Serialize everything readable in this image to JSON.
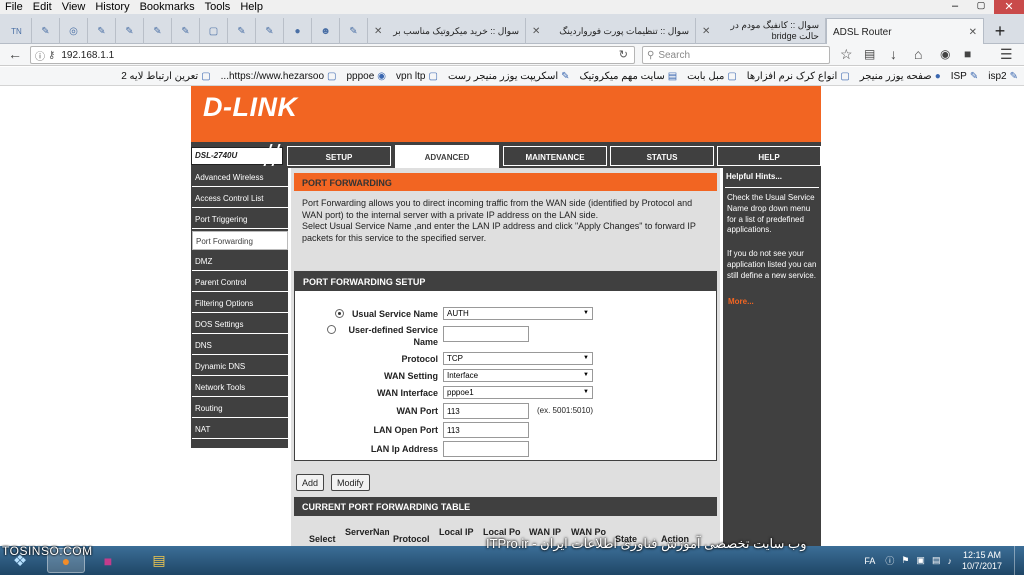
{
  "menubar": {
    "items": [
      "File",
      "Edit",
      "View",
      "History",
      "Bookmarks",
      "Tools",
      "Help"
    ]
  },
  "tabs": [
    {
      "label": "سوال :: خرید میکروتیک مناسب بر"
    },
    {
      "label": "سوال :: تنظیمات پورت فورواردینگ"
    },
    {
      "label": "سوال :: کانفیگ مودم در حالت bridge"
    },
    {
      "label": "ADSL Router"
    }
  ],
  "navbar": {
    "url": "192.168.1.1",
    "search_placeholder": "Search"
  },
  "bookmarks": [
    "isp2",
    "ISP",
    "صفحه یوزر منیجر",
    "انواع کرک نرم افزارها",
    "مبل بابت",
    "سایت مهم میکروتیک",
    "اسکریپت یوزر منیجر رست",
    "vpn ltp",
    "pppoe",
    "https://www.hezarsoo...",
    "تعرین ارتباط لایه 2"
  ],
  "router": {
    "logo": "D-LINK",
    "model": "DSL-2740U",
    "tabs": [
      "SETUP",
      "ADVANCED",
      "MAINTENANCE",
      "STATUS",
      "HELP"
    ],
    "left_nav": [
      "Advanced Wireless",
      "Access Control List",
      "Port Triggering",
      "Port Forwarding",
      "DMZ",
      "Parent Control",
      "Filtering Options",
      "DOS Settings",
      "DNS",
      "Dynamic DNS",
      "Network Tools",
      "Routing",
      "NAT"
    ],
    "pf_title": "PORT FORWARDING",
    "pf_text_1": "Port Forwarding allows you to direct incoming traffic from the WAN side (identified by Protocol and WAN port) to the internal server with a private IP address on the LAN side.",
    "pf_text_2": "Select Usual Service Name ,and enter the LAN IP address and click \"Apply Changes\" to forward IP packets for this service to the specified server.",
    "setup_title": "PORT FORWARDING SETUP",
    "form": {
      "usual_label": "Usual Service Name",
      "usual_value": "AUTH",
      "user_defined_label": "User-defined Service Name",
      "protocol_label": "Protocol",
      "protocol_value": "TCP",
      "wan_setting_label": "WAN Setting",
      "wan_setting_value": "Interface",
      "wan_interface_label": "WAN Interface",
      "wan_interface_value": "pppoe1",
      "wan_port_label": "WAN Port",
      "wan_port_value": "113",
      "wan_port_example": "(ex. 5001:5010)",
      "lan_open_port_label": "LAN Open Port",
      "lan_open_port_value": "113",
      "lan_ip_label": "LAN Ip Address",
      "lan_ip_value": ""
    },
    "add_button": "Add",
    "modify_button": "Modify",
    "table_title": "CURRENT PORT FORWARDING TABLE",
    "table_headers": [
      "Select",
      "ServerName",
      "Protocol",
      "Local IP",
      "Local Po",
      "WAN IP",
      "WAN Po",
      "State",
      "Action"
    ],
    "hints_title": "Helpful Hints...",
    "hint_1": "Check the Usual Service Name drop down menu for a list of predefined applications.",
    "hint_2": "If you do not see your application listed you can still define a new service.",
    "hint_more": "More..."
  },
  "watermark": {
    "left": "TOSINSO.COM",
    "right": "وب سایت تخصصی آموزش فناوری اطلاعات ایران - ITPro.ir"
  },
  "taskbar": {
    "lang": "FA",
    "time": "12:15 AM",
    "date": "10/7/2017"
  }
}
